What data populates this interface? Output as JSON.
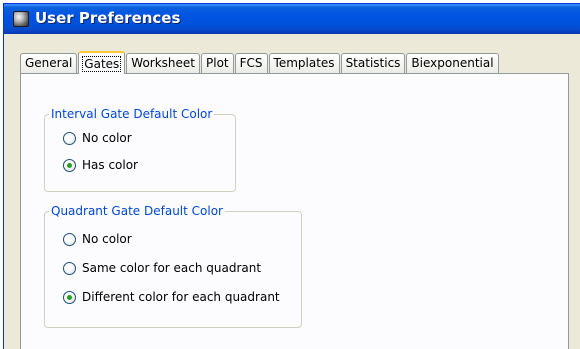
{
  "window": {
    "title": "User Preferences",
    "icon": "flowjo-app-icon"
  },
  "tabs": [
    {
      "label": "General"
    },
    {
      "label": "Gates",
      "active": true
    },
    {
      "label": "Worksheet"
    },
    {
      "label": "Plot"
    },
    {
      "label": "FCS"
    },
    {
      "label": "Templates"
    },
    {
      "label": "Statistics"
    },
    {
      "label": "Biexponential"
    }
  ],
  "interval_group": {
    "legend": "Interval Gate Default Color",
    "options": [
      {
        "label": "No color",
        "checked": false
      },
      {
        "label": "Has color",
        "checked": true
      }
    ]
  },
  "quadrant_group": {
    "legend": "Quadrant Gate Default Color",
    "options": [
      {
        "label": "No color",
        "checked": false
      },
      {
        "label": "Same color for each quadrant",
        "checked": false
      },
      {
        "label": "Different color for each quadrant",
        "checked": true
      }
    ]
  },
  "colors": {
    "titlebar": "#0054e3",
    "legend_text": "#0046d5",
    "active_tab_accent": "#ffc83c",
    "radio_selected": "#21a121"
  }
}
